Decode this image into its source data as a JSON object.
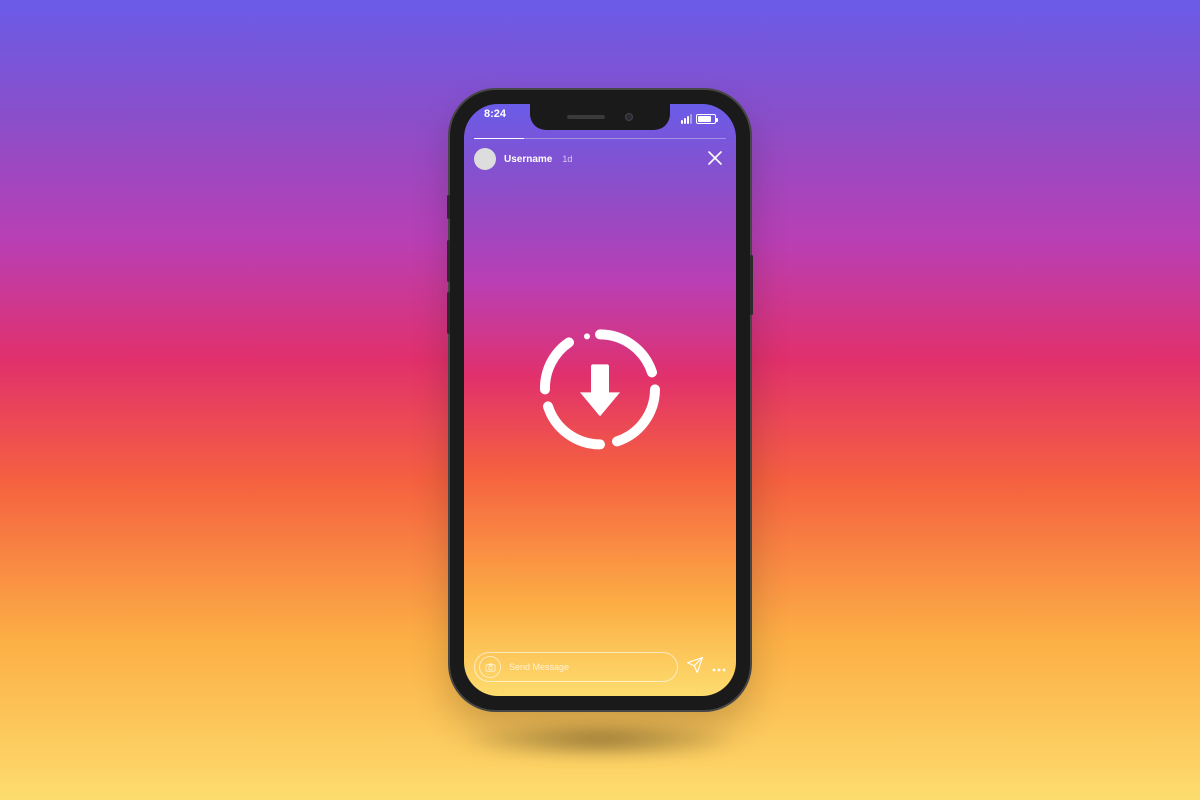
{
  "status": {
    "time": "8:24"
  },
  "story": {
    "username": "Username",
    "timestamp": "1d",
    "message_placeholder": "Send Message"
  }
}
